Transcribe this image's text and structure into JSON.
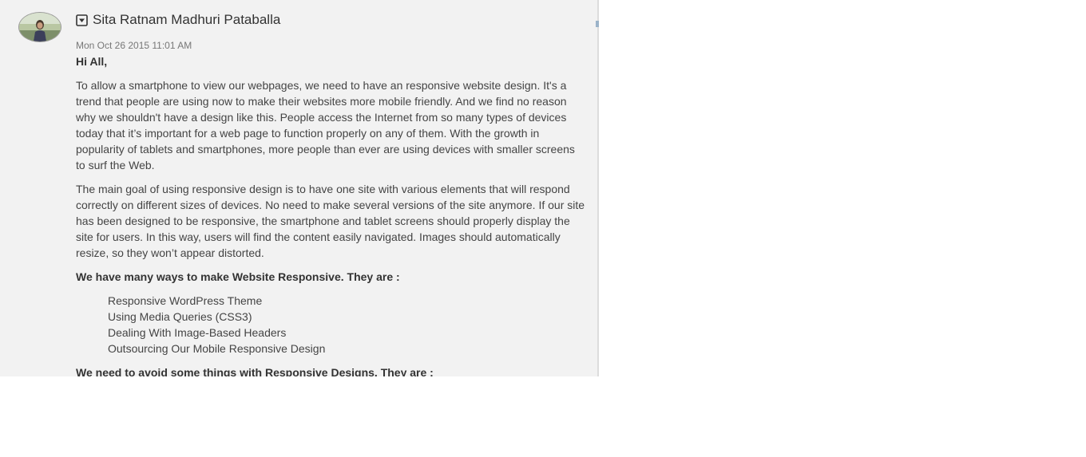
{
  "post": {
    "avatar_icon": "user-photo",
    "menu_icon": "dropdown-square-icon",
    "author": "Sita Ratnam Madhuri Pataballa",
    "timestamp": "Mon Oct 26 2015 11:01 AM",
    "greeting": "Hi All,",
    "paragraph1": "To allow a smartphone to view our webpages, we need to have an responsive website design. It's a trend that people are using now to make their websites more mobile friendly. And we find no reason why we shouldn't have a design like this. People access the Internet from so many types of devices today that it’s important for a web page to function properly on any of them. With the growth in popularity of tablets and smartphones, more people than ever are using devices with smaller screens to surf the Web.",
    "paragraph2": "The main goal of using responsive design is to have one site with various elements that will respond correctly on different sizes of devices. No need to make several versions of the site anymore. If our site has been designed to be responsive, the smartphone and tablet screens should properly display the site for users. In this way, users will find the content easily navigated. Images should automatically resize, so they won’t appear distorted.",
    "ways_heading": "We have many ways to make Website Responsive. They are :",
    "ways": [
      "Responsive WordPress Theme",
      "Using Media Queries (CSS3)",
      "Dealing With Image-Based Headers",
      "Outsourcing Our Mobile Responsive Design"
    ],
    "avoid_heading": "We need to avoid some things with Responsive Designs. They are :"
  }
}
